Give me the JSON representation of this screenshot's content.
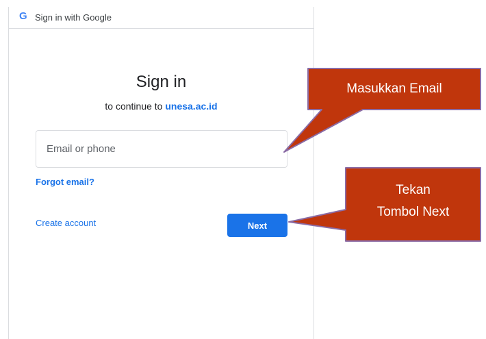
{
  "topbar": {
    "logo": "G",
    "label": "Sign in with Google"
  },
  "signin": {
    "heading": "Sign in",
    "subtitle_prefix": "to continue to",
    "domain": "unesa.ac.id",
    "email_placeholder": "Email or phone",
    "email_value": "",
    "forgot_label": "Forgot email?",
    "create_label": "Create account",
    "next_label": "Next"
  },
  "callouts": {
    "email": "Masukkan Email",
    "next_line1": "Tekan",
    "next_line2": "Tombol Next",
    "fill_color": "#c0360c",
    "border_color": "#8a6ba5"
  },
  "colors": {
    "accent": "#1a73e8",
    "border": "#dadce0"
  }
}
